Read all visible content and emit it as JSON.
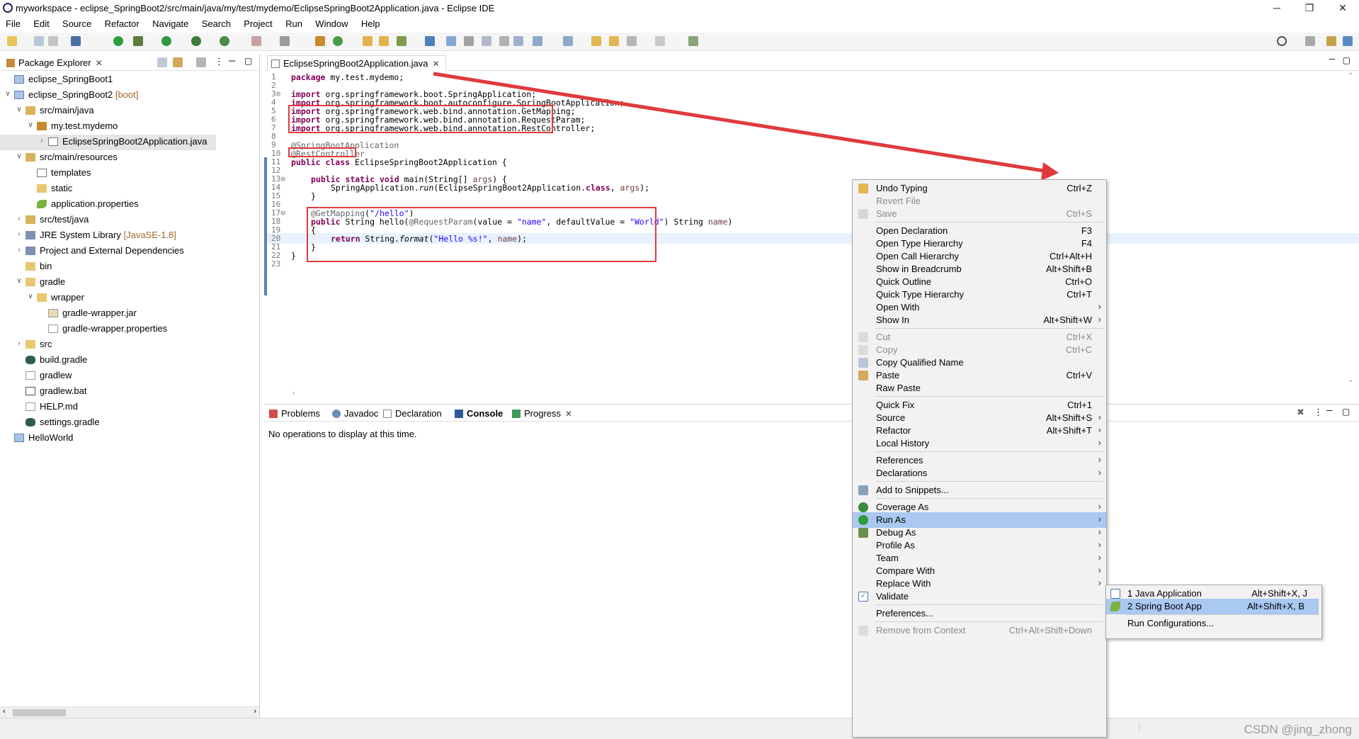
{
  "window": {
    "title": "myworkspace - eclipse_SpringBoot2/src/main/java/my/test/mydemo/EclipseSpringBoot2Application.java - Eclipse IDE",
    "minimize": "─",
    "restore": "❐",
    "close": "✕"
  },
  "menubar": [
    "File",
    "Edit",
    "Source",
    "Refactor",
    "Navigate",
    "Search",
    "Project",
    "Run",
    "Window",
    "Help"
  ],
  "package_explorer": {
    "tab_label": "Package Explorer",
    "tree": [
      {
        "label": "eclipse_SpringBoot1",
        "decoration": ""
      },
      {
        "label": "eclipse_SpringBoot2",
        "decoration": " [boot]"
      },
      {
        "label": "src/main/java",
        "decoration": ""
      },
      {
        "label": "my.test.mydemo",
        "decoration": ""
      },
      {
        "label": "EclipseSpringBoot2Application.java",
        "decoration": ""
      },
      {
        "label": "src/main/resources",
        "decoration": ""
      },
      {
        "label": "templates",
        "decoration": ""
      },
      {
        "label": "static",
        "decoration": ""
      },
      {
        "label": "application.properties",
        "decoration": ""
      },
      {
        "label": "src/test/java",
        "decoration": ""
      },
      {
        "label": "JRE System Library",
        "decoration": " [JavaSE-1.8]"
      },
      {
        "label": "Project and External Dependencies",
        "decoration": ""
      },
      {
        "label": "bin",
        "decoration": ""
      },
      {
        "label": "gradle",
        "decoration": ""
      },
      {
        "label": "wrapper",
        "decoration": ""
      },
      {
        "label": "gradle-wrapper.jar",
        "decoration": ""
      },
      {
        "label": "gradle-wrapper.properties",
        "decoration": ""
      },
      {
        "label": "src",
        "decoration": ""
      },
      {
        "label": "build.gradle",
        "decoration": ""
      },
      {
        "label": "gradlew",
        "decoration": ""
      },
      {
        "label": "gradlew.bat",
        "decoration": ""
      },
      {
        "label": "HELP.md",
        "decoration": ""
      },
      {
        "label": "settings.gradle",
        "decoration": ""
      },
      {
        "label": "HelloWorld",
        "decoration": ""
      }
    ]
  },
  "editor": {
    "tab_label": "EclipseSpringBoot2Application.java",
    "line_numbers": [
      "1",
      "2",
      "3⊖",
      "4",
      "5",
      "6",
      "7",
      "8",
      "9",
      "10",
      "11",
      "12",
      "13⊖",
      "14",
      "15",
      "16",
      "17⊖",
      "18",
      "19",
      "20",
      "21",
      "22",
      "23"
    ],
    "lines": {
      "l1a": "package",
      "l1b": " my.test.mydemo;",
      "l3a": "import",
      "l3b": " org.springframework.boot.SpringApplication;",
      "l4a": "import",
      "l4b": " org.springframework.boot.autoconfigure.SpringBootApplication;",
      "l5a": "import",
      "l5b": " org.springframework.web.bind.annotation.GetMapping;",
      "l6a": "import",
      "l6b": " org.springframework.web.bind.annotation.RequestParam;",
      "l7a": "import",
      "l7b": " org.springframework.web.bind.annotation.RestController;",
      "l9": "@SpringBootApplication",
      "l10": "@RestController",
      "l11a": "public class",
      "l11b": " EclipseSpringBoot2Application {",
      "l13a": "public static void",
      "l13b": " main(String[] ",
      "l13c": "args",
      "l13d": ") {",
      "l14a": "SpringApplication.",
      "l14b": "run",
      "l14c": "(EclipseSpringBoot2Application.",
      "l14d": "class",
      "l14e": ", ",
      "l14f": "args",
      "l14g": ");",
      "l15": "}",
      "l17a": "@GetMapping",
      "l17b": "(",
      "l17c": "\"/hello\"",
      "l17d": ")",
      "l18a": "public",
      "l18b": " String hello(",
      "l18c": "@RequestParam",
      "l18d": "(value = ",
      "l18e": "\"name\"",
      "l18f": ", defaultValue = ",
      "l18g": "\"World\"",
      "l18h": ") String ",
      "l18i": "name",
      "l18j": ")",
      "l19": "{",
      "l20a": "return",
      "l20b": " String.",
      "l20c": "format",
      "l20d": "(",
      "l20e": "\"Hello %s!\"",
      "l20f": ", ",
      "l20g": "name",
      "l20h": ");",
      "l21": "}",
      "l22": "}"
    }
  },
  "bottom_views": {
    "tabs": [
      "Problems",
      "Javadoc",
      "Declaration",
      "Console",
      "Progress"
    ],
    "active": "Console",
    "message": "No operations to display at this time."
  },
  "context_menu": {
    "items": [
      {
        "label": "Undo Typing",
        "key": "Ctrl+Z"
      },
      {
        "label": "Revert File",
        "key": ""
      },
      {
        "label": "Save",
        "key": "Ctrl+S"
      },
      {
        "label": "Open Declaration",
        "key": "F3"
      },
      {
        "label": "Open Type Hierarchy",
        "key": "F4"
      },
      {
        "label": "Open Call Hierarchy",
        "key": "Ctrl+Alt+H"
      },
      {
        "label": "Show in Breadcrumb",
        "key": "Alt+Shift+B"
      },
      {
        "label": "Quick Outline",
        "key": "Ctrl+O"
      },
      {
        "label": "Quick Type Hierarchy",
        "key": "Ctrl+T"
      },
      {
        "label": "Open With",
        "key": ""
      },
      {
        "label": "Show In",
        "key": "Alt+Shift+W"
      },
      {
        "label": "Cut",
        "key": "Ctrl+X"
      },
      {
        "label": "Copy",
        "key": "Ctrl+C"
      },
      {
        "label": "Copy Qualified Name",
        "key": ""
      },
      {
        "label": "Paste",
        "key": "Ctrl+V"
      },
      {
        "label": "Raw Paste",
        "key": ""
      },
      {
        "label": "Quick Fix",
        "key": "Ctrl+1"
      },
      {
        "label": "Source",
        "key": "Alt+Shift+S"
      },
      {
        "label": "Refactor",
        "key": "Alt+Shift+T"
      },
      {
        "label": "Local History",
        "key": ""
      },
      {
        "label": "References",
        "key": ""
      },
      {
        "label": "Declarations",
        "key": ""
      },
      {
        "label": "Add to Snippets...",
        "key": ""
      },
      {
        "label": "Coverage As",
        "key": ""
      },
      {
        "label": "Run As",
        "key": ""
      },
      {
        "label": "Debug As",
        "key": ""
      },
      {
        "label": "Profile As",
        "key": ""
      },
      {
        "label": "Team",
        "key": ""
      },
      {
        "label": "Compare With",
        "key": ""
      },
      {
        "label": "Replace With",
        "key": ""
      },
      {
        "label": "Validate",
        "key": ""
      },
      {
        "label": "Preferences...",
        "key": ""
      },
      {
        "label": "Remove from Context",
        "key": "Ctrl+Alt+Shift+Down"
      }
    ],
    "submenu_arrow": "›"
  },
  "run_as_submenu": {
    "items": [
      {
        "label": "1 Java Application",
        "key": "Alt+Shift+X, J"
      },
      {
        "label": "2 Spring Boot App",
        "key": "Alt+Shift+X, B"
      },
      {
        "label": "Run Configurations...",
        "key": ""
      }
    ]
  },
  "watermark": "CSDN @jing_zhong",
  "colors": {
    "highlight": "#a9c8f2",
    "annotation_box": "#e03a3e",
    "keyword": "#7f0055",
    "string": "#2a00ff"
  }
}
